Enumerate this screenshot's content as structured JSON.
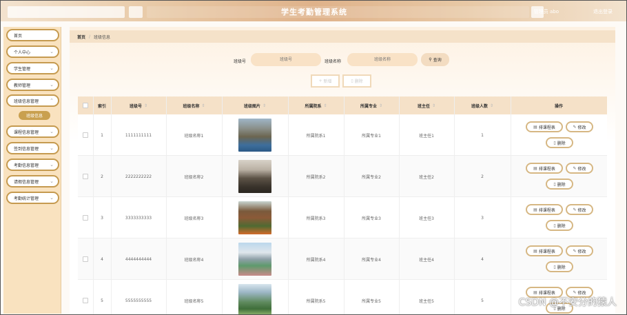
{
  "header": {
    "title": "学生考勤管理系统",
    "user": "管理员 abo",
    "logout": "退出登录"
  },
  "sidebar": {
    "items": [
      {
        "label": "首页",
        "chevron": false
      },
      {
        "label": "个人中心",
        "chevron": true
      },
      {
        "label": "学生管理",
        "chevron": true
      },
      {
        "label": "教师管理",
        "chevron": true
      },
      {
        "label": "班级信息管理",
        "chevron": true
      },
      {
        "label": "课程信息管理",
        "chevron": true
      },
      {
        "label": "签到信息管理",
        "chevron": true
      },
      {
        "label": "考勤信息管理",
        "chevron": true
      },
      {
        "label": "请假信息管理",
        "chevron": true
      },
      {
        "label": "考勤统计管理",
        "chevron": true
      }
    ],
    "active_sub": "班级信息"
  },
  "breadcrumb": {
    "home": "首页",
    "separator": "/",
    "current": "班级信息"
  },
  "search": {
    "class_no_label": "班级号",
    "class_no_placeholder": "班级号",
    "class_name_label": "班级名称",
    "class_name_placeholder": "班级名称",
    "query_label": "查询"
  },
  "actions": {
    "add_label": "新增",
    "delete_label": "删除"
  },
  "table": {
    "headers": {
      "index": "索引",
      "class_no": "班级号",
      "class_name": "班级名称",
      "photo": "班级图片",
      "college": "所属院系",
      "major": "所属专业",
      "teacher": "班主任",
      "count": "班级人数",
      "ops": "操作"
    },
    "rows": [
      {
        "index": "1",
        "class_no": "1111111111",
        "class_name": "班级名称1",
        "college": "所属院系1",
        "major": "所属专业1",
        "teacher": "班主任1",
        "count": "1"
      },
      {
        "index": "2",
        "class_no": "2222222222",
        "class_name": "班级名称2",
        "college": "所属院系2",
        "major": "所属专业2",
        "teacher": "班主任2",
        "count": "2"
      },
      {
        "index": "3",
        "class_no": "3333333333",
        "class_name": "班级名称3",
        "college": "所属院系3",
        "major": "所属专业3",
        "teacher": "班主任3",
        "count": "3"
      },
      {
        "index": "4",
        "class_no": "4444444444",
        "class_name": "班级名称4",
        "college": "所属院系4",
        "major": "所属专业4",
        "teacher": "班主任4",
        "count": "4"
      },
      {
        "index": "5",
        "class_no": "5555555555",
        "class_name": "班级名称5",
        "college": "所属院系5",
        "major": "所属专业5",
        "teacher": "班主任5",
        "count": "5"
      }
    ],
    "row_actions": {
      "schedule": "排课程表",
      "edit": "修改",
      "delete": "删除"
    }
  },
  "watermark": "CSDN @不安分的猿人"
}
